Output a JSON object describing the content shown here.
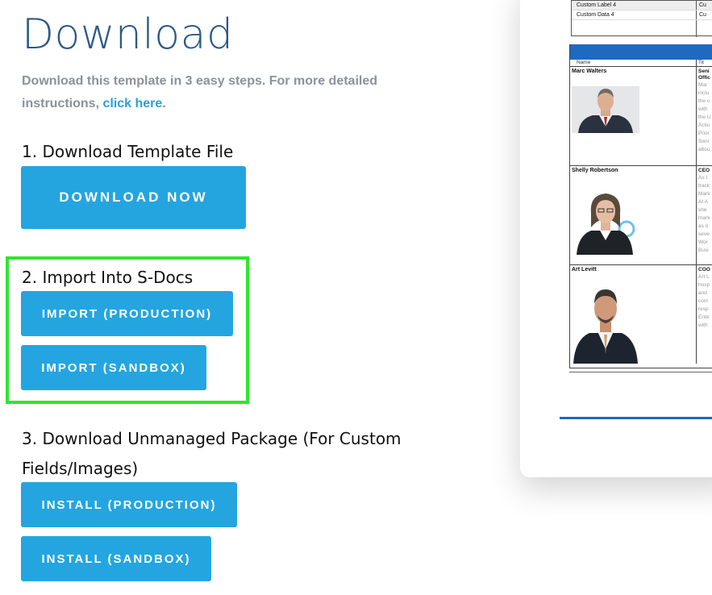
{
  "page": {
    "title": "Download",
    "intro_text": "Download this template in 3 easy steps. For more detailed instructions,",
    "intro_link": "click here",
    "intro_end": "."
  },
  "steps": {
    "step1_label": "1. Download Template File",
    "step1_button": "DOWNLOAD NOW",
    "step2_label": "2. Import Into S-Docs",
    "step2_button_prod": "IMPORT (PRODUCTION)",
    "step2_button_sandbox": "IMPORT (SANDBOX)",
    "step3_label": "3. Download Unmanaged Package (For Custom Fields/Images)",
    "step3_button_prod": "INSTALL (PRODUCTION)",
    "step3_button_sandbox": "INSTALL (SANDBOX)"
  },
  "preview": {
    "top_rows": [
      {
        "label": "Custom Label 4",
        "value": "Cu"
      },
      {
        "label": "Custom Data 4",
        "value": "Cu"
      }
    ],
    "header_name": "Name",
    "header_title": "Tit",
    "people": [
      {
        "name": "Marc Walters",
        "title_lines": [
          "Seni",
          "Offic"
        ],
        "bio_lines": [
          "Mar",
          "inclu",
          "the c",
          "with",
          "the U",
          "Actio",
          "Prior",
          "Seni",
          "abou"
        ]
      },
      {
        "name": "Shelly Robertson",
        "title_lines": [
          "CEO"
        ],
        "bio_lines": [
          "As t",
          "track",
          "Mark",
          "At A",
          "she",
          "mark",
          "as o",
          "seve",
          "Wor",
          "Busi"
        ]
      },
      {
        "name": "Art Levitt",
        "title_lines": [
          "COO"
        ],
        "bio_lines": [
          "Art L",
          "hosp",
          "and",
          "com",
          "resp",
          "Ente",
          "with"
        ]
      }
    ]
  },
  "colors": {
    "title": "#2b5a86",
    "button": "#24a5e0",
    "link": "#24a2dd",
    "highlight": "#2ee62e",
    "doc_blue": "#1f69c1"
  }
}
